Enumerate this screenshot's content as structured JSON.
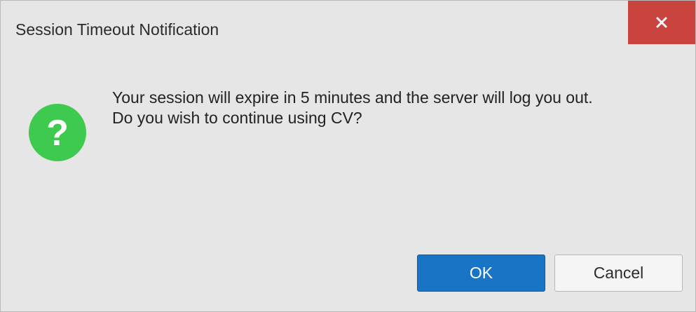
{
  "dialog": {
    "title": "Session Timeout Notification",
    "close_icon": "close-icon",
    "message_line1": "Your session will expire in 5 minutes and the server will log you out.",
    "message_line2": "Do you wish to continue using CV?",
    "icon": "question-icon",
    "ok_label": "OK",
    "cancel_label": "Cancel"
  },
  "colors": {
    "close_button": "#c9433f",
    "question_icon": "#3ec94f",
    "ok_button": "#1874c4",
    "background": "#e6e6e6"
  }
}
